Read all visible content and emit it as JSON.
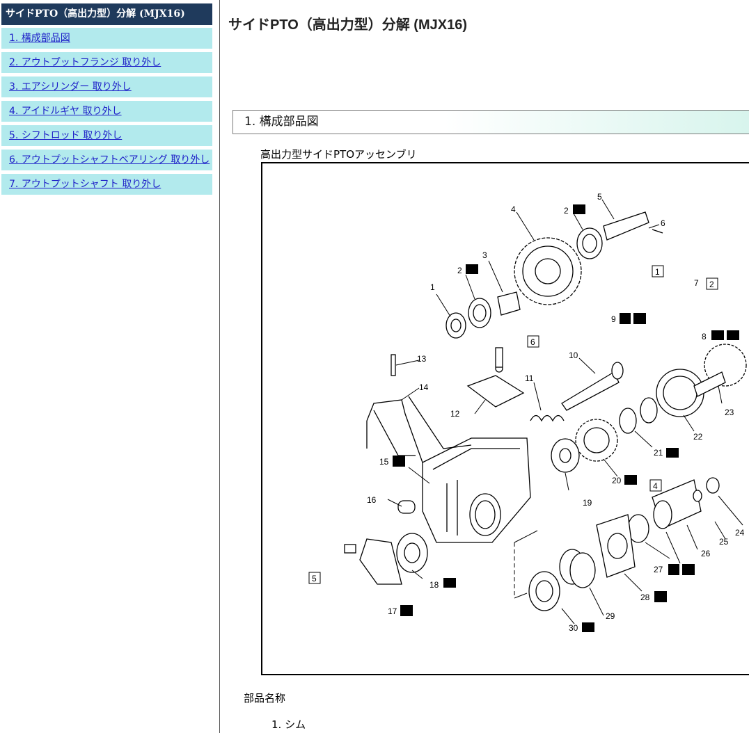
{
  "sidebar": {
    "title": "サイドPTO（高出力型）分解 (MJX16)",
    "items": [
      {
        "label": "1. 構成部品図"
      },
      {
        "label": "2. アウトプットフランジ 取り外し"
      },
      {
        "label": "3. エアシリンダー 取り外し"
      },
      {
        "label": "4. アイドルギヤ 取り外し"
      },
      {
        "label": "5. シフトロッド 取り外し"
      },
      {
        "label": "6. アウトプットシャフトベアリング 取り外し"
      },
      {
        "label": "7. アウトプットシャフト 取り外し"
      }
    ]
  },
  "main": {
    "page_title": "サイドPTO（高出力型）分解 (MJX16)",
    "section_title": "1. 構成部品図",
    "figure_caption": "高出力型サイドPTOアッセンブリ",
    "parts_heading": "部品名称",
    "parts": [
      "1. シム"
    ]
  },
  "figure": {
    "part_numbers": [
      "1",
      "2",
      "2",
      "3",
      "4",
      "5",
      "6",
      "7",
      "8",
      "9",
      "10",
      "11",
      "12",
      "13",
      "14",
      "15",
      "16",
      "17",
      "18",
      "19",
      "20",
      "21",
      "22",
      "23",
      "24",
      "25",
      "26",
      "27",
      "28",
      "29",
      "30"
    ],
    "boxed_refs": [
      "1",
      "2",
      "4",
      "5",
      "6"
    ],
    "icon_names": [
      "oil-can-icon",
      "grease-icon",
      "do-not-reuse-icon",
      "sealant-icon"
    ]
  },
  "colors": {
    "sidebar_title_bg": "#1f3a5c",
    "sidebar_item_bg": "#b2eaed",
    "link": "#1d1fc8",
    "section_gradient_end": "#d6f4ec"
  }
}
